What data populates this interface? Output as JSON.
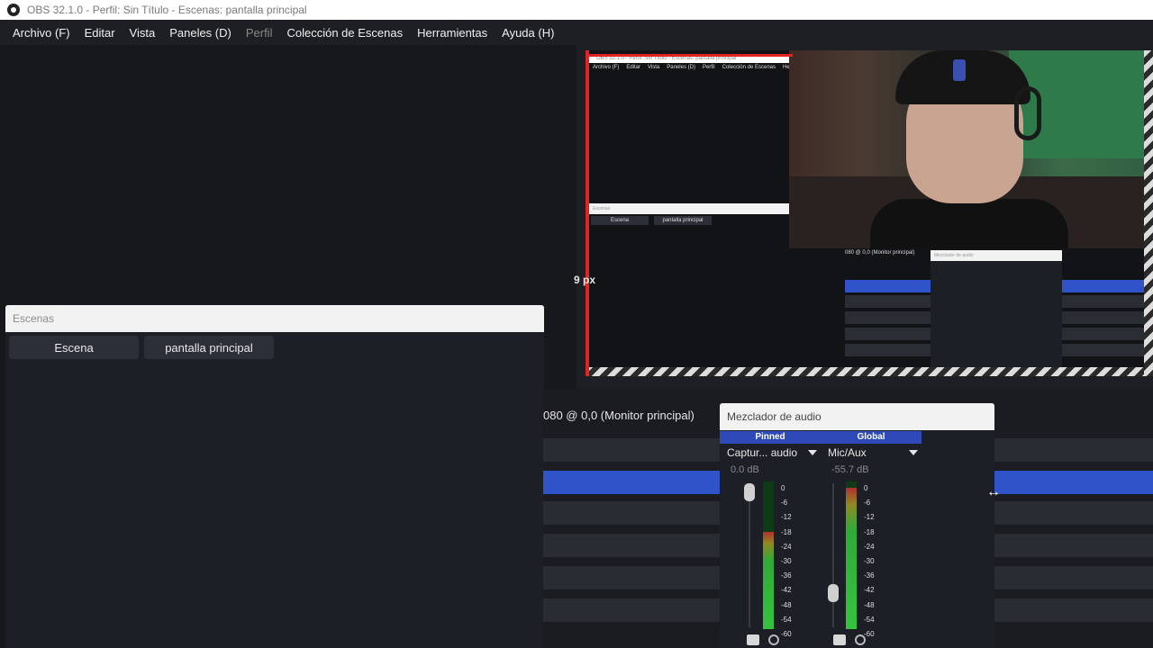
{
  "window": {
    "title": "OBS 32.1.0 - Perfil: Sin Título - Escenas: pantalla principal"
  },
  "menu": {
    "items": [
      {
        "label": "Archivo (F)"
      },
      {
        "label": "Editar"
      },
      {
        "label": "Vista"
      },
      {
        "label": "Paneles (D)"
      },
      {
        "label": "Perfil"
      },
      {
        "label": "Colección de Escenas"
      },
      {
        "label": "Herramientas"
      },
      {
        "label": "Ayuda (H)"
      }
    ]
  },
  "scenes_dock": {
    "title": "Escenas",
    "buttons": [
      "Escena",
      "pantalla principal"
    ]
  },
  "preview": {
    "distance_label": "9 px",
    "mini_title": "OBS 32.1.0 - Perfil: Sin Título - Escenas: pantalla principal",
    "mini_menu": [
      "Archivo (F)",
      "Editar",
      "Vista",
      "Paneles (D)",
      "Perfil",
      "Colección de Escenas",
      "Her"
    ],
    "mini_scenes_title": "Escenas",
    "mini_scene_buttons": [
      "Escena",
      "pantalla principal"
    ],
    "mini_mixer_title": "Mezclador de audio",
    "mini_monitor": "080 @ 0,0 (Monitor principal)"
  },
  "monitor_label": "080 @ 0,0 (Monitor principal)",
  "mixer": {
    "title": "Mezclador de audio",
    "channels": [
      {
        "head": "Pinned",
        "name": "Captur... audio",
        "db": "0.0 dB",
        "level": 0.66,
        "fader": 1.0
      },
      {
        "head": "Global",
        "name": "Mic/Aux",
        "db": "-55.7 dB",
        "level": 0.96,
        "fader": 0.2
      }
    ],
    "scale": [
      "0",
      "-6",
      "-12",
      "-18",
      "-24",
      "-30",
      "-36",
      "-42",
      "-48",
      "-54",
      "-60"
    ]
  }
}
